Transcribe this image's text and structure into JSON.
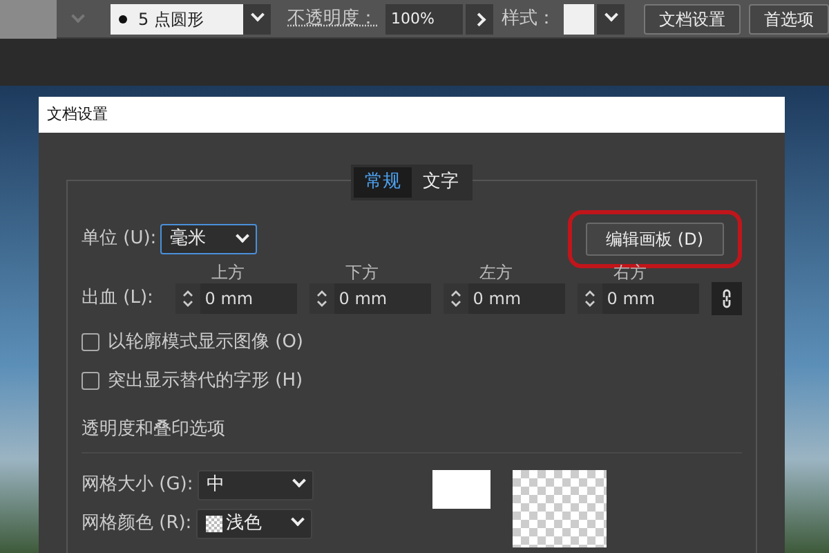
{
  "toolbar": {
    "brush": "5 点圆形",
    "opacity_label": "不透明度：",
    "opacity_value": "100%",
    "style_label": "样式：",
    "buttons": [
      "文档设置",
      "首选项"
    ]
  },
  "dialog": {
    "title": "文档设置",
    "tabs": [
      {
        "label": "常规",
        "selected": true
      },
      {
        "label": "文字",
        "selected": false
      }
    ],
    "unit_label": "单位 (U):",
    "unit_value": "毫米",
    "edit_artboard_button": {
      "label": "编辑画板 (D)",
      "highlighted": true
    },
    "bleed_label": "出血 (L):",
    "bleed_fields": [
      {
        "label": "上方",
        "value": "0 mm"
      },
      {
        "label": "下方",
        "value": "0 mm"
      },
      {
        "label": "左方",
        "value": "0 mm"
      },
      {
        "label": "右方",
        "value": "0 mm"
      }
    ],
    "checkboxes": [
      {
        "label": "以轮廓模式显示图像 (O)",
        "checked": false
      },
      {
        "label": "突出显示替代的字形 (H)",
        "checked": false
      }
    ],
    "section_title": "透明度和叠印选项",
    "grid_size": {
      "label": "网格大小 (G):",
      "value": "中"
    },
    "grid_color": {
      "label": "网格颜色 (R):",
      "value": "浅色"
    }
  }
}
